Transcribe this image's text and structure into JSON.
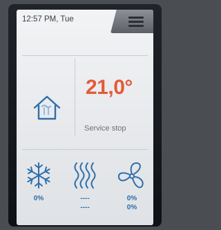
{
  "header": {
    "clock": "12:57 PM, Tue"
  },
  "main": {
    "temperature": "21,0°",
    "status": "Service stop"
  },
  "bottom": {
    "cooling": {
      "value": "0%"
    },
    "heating": {
      "value1": "----",
      "value2": "----"
    },
    "fan": {
      "value1": "0%",
      "value2": "0%"
    }
  },
  "colors": {
    "temperature": "#e45a38",
    "icon": "#2f6eab",
    "screen_bg": "#eeeff1",
    "menu_tab": "#74787e"
  },
  "icons": [
    "menu-icon",
    "home-icon",
    "snowflake-icon",
    "heating-icon",
    "fan-icon"
  ]
}
